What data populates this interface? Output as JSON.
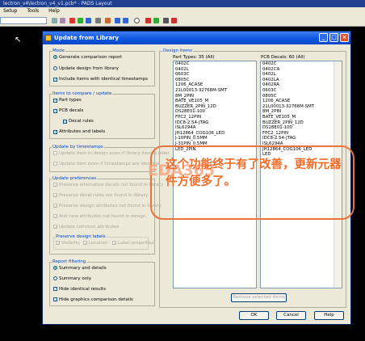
{
  "app": {
    "title": "lectron_v4\\lectron_v4_v1.pcb* - PADS Layout",
    "menu": [
      "Setup",
      "Tools",
      "Help"
    ]
  },
  "dialog": {
    "title": "Update from Library",
    "mode": {
      "label": "Mode",
      "generate": "Generate comparison report",
      "update": "Update design from library",
      "include_ts": "Include items with identical timestamps"
    },
    "items": {
      "label": "Items to compare / update",
      "part_types": "Part types",
      "pcb_decals": "PCB decals",
      "decal_rules": "Decal rules",
      "attributes": "Attributes and labels"
    },
    "timestamps": {
      "label": "Update by timestamps",
      "opt1": "Update item in design even if library item is older",
      "opt2": "Update item even if timestamps are identical"
    },
    "prefs": {
      "label": "Update preferences",
      "p1": "Preserve alternative decals not found in library",
      "p2": "Preserve decal rules not found in library",
      "p3": "Preserve design attributes not found in library",
      "p4": "Add new attributes not found in design",
      "p5": "Update common attributes",
      "labels_group": "Preserve design labels",
      "visibility": "Visibility",
      "location": "Location",
      "label_props": "Label properties"
    },
    "report": {
      "label": "Report filtering",
      "summary_details": "Summary and details",
      "summary_only": "Summary only",
      "hide_identical": "Hide identical results",
      "hide_graphics": "Hide graphics comparison details"
    },
    "design_items_label": "Design items",
    "part_types_header": "Part Types: 35 (All)",
    "pcb_decals_header": "PCB Decals: 60 (All)",
    "part_types": [
      "0402C",
      "0402L",
      "0603C",
      "0805C",
      "1206_ACASE",
      "21L00013-32768M-SMT",
      "8M_2PIN",
      "BATE_VE105_M",
      "BUZZER_2PIN_12D",
      "DS28E01-100",
      "FPC2_12PIN",
      "IDC8-2.54-JTAG",
      "ISL6294A",
      "JH12864_COG106_LED",
      "J-10PIN_0.5MM",
      "J-31PIN_0.5MM",
      "LED_2PIN"
    ],
    "pcb_decals": [
      "0402C",
      "0402CA",
      "0402L",
      "0402LA",
      "0402RA",
      "0603C",
      "0805C",
      "1206_ACASE",
      "21L00013-32768M-SMT",
      "8M_2PIN",
      "BATE_VE105_M",
      "BUZZER_2PIN_12D",
      "DS28E01-100",
      "FPC2_12PIN",
      "IDC8-2.54-JTAG",
      "ISL6294A",
      "JH12864_COG106_LED",
      "LED"
    ],
    "remove_btn": "Remove selected items",
    "ok": "OK",
    "cancel": "Cancel",
    "help": "Help"
  },
  "annotation": {
    "watermark": "EDA365",
    "text": "这个功能终于有了改善，更新元器件方便多了。"
  },
  "colors": {
    "title_bar": "#0a55e0",
    "group_label": "#0046d5",
    "annotation": "#f06d2a"
  }
}
